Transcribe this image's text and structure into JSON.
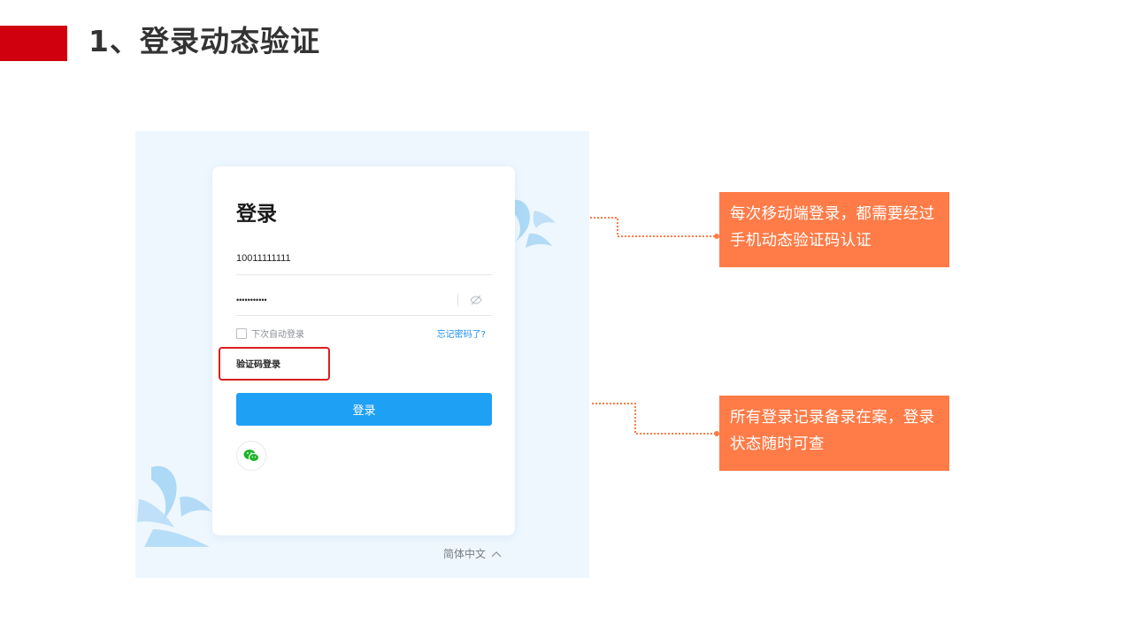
{
  "slide": {
    "title": "1、登录动态验证",
    "accent_color": "#d0000f"
  },
  "login": {
    "heading": "登录",
    "username_value": "10011111111",
    "password_masked": "•••••••••••",
    "remember_label": "下次自动登录",
    "remember_checked": false,
    "forgot_link": "忘记密码了?",
    "sms_login_link": "验证码登录",
    "submit_label": "登录",
    "language": "简体中文",
    "button_color": "#1ea0f5",
    "link_color": "#1b8ff0"
  },
  "callouts": [
    {
      "text": "每次移动端登录，都需要经过手机动态验证码认证"
    },
    {
      "text": "所有登录记录备录在案，登录状态随时可查"
    }
  ],
  "callout_color": "#ff7b47",
  "highlight_color": "#d81e1e",
  "icons": [
    "eye-off-icon",
    "wechat-icon",
    "chevron-up-icon"
  ]
}
